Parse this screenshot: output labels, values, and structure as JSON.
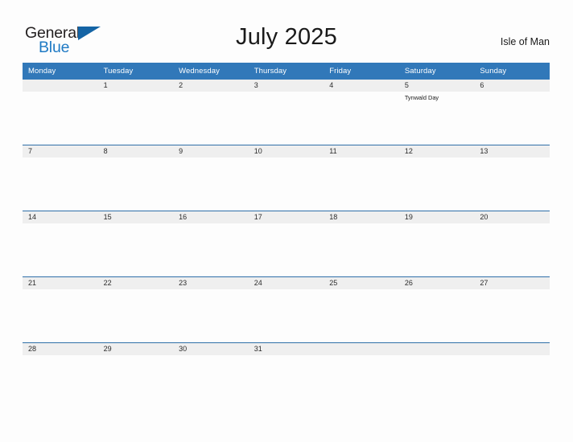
{
  "brand": {
    "name_part1": "General",
    "name_part2": "Blue",
    "flag_icon": "flag-triangle-icon",
    "accent_color": "#1f7ac4",
    "flag_color": "#1464a5"
  },
  "header": {
    "title": "July 2025",
    "locale": "Isle of Man"
  },
  "calendar": {
    "header_bg_color": "#3178b9",
    "daynum_band_color": "#efefef",
    "row_border_color": "#2f6fa8",
    "weekdays": [
      "Monday",
      "Tuesday",
      "Wednesday",
      "Thursday",
      "Friday",
      "Saturday",
      "Sunday"
    ],
    "weeks": [
      [
        {
          "day": "",
          "events": []
        },
        {
          "day": "1",
          "events": []
        },
        {
          "day": "2",
          "events": []
        },
        {
          "day": "3",
          "events": []
        },
        {
          "day": "4",
          "events": []
        },
        {
          "day": "5",
          "events": [
            "Tynwald Day"
          ]
        },
        {
          "day": "6",
          "events": []
        }
      ],
      [
        {
          "day": "7",
          "events": []
        },
        {
          "day": "8",
          "events": []
        },
        {
          "day": "9",
          "events": []
        },
        {
          "day": "10",
          "events": []
        },
        {
          "day": "11",
          "events": []
        },
        {
          "day": "12",
          "events": []
        },
        {
          "day": "13",
          "events": []
        }
      ],
      [
        {
          "day": "14",
          "events": []
        },
        {
          "day": "15",
          "events": []
        },
        {
          "day": "16",
          "events": []
        },
        {
          "day": "17",
          "events": []
        },
        {
          "day": "18",
          "events": []
        },
        {
          "day": "19",
          "events": []
        },
        {
          "day": "20",
          "events": []
        }
      ],
      [
        {
          "day": "21",
          "events": []
        },
        {
          "day": "22",
          "events": []
        },
        {
          "day": "23",
          "events": []
        },
        {
          "day": "24",
          "events": []
        },
        {
          "day": "25",
          "events": []
        },
        {
          "day": "26",
          "events": []
        },
        {
          "day": "27",
          "events": []
        }
      ],
      [
        {
          "day": "28",
          "events": []
        },
        {
          "day": "29",
          "events": []
        },
        {
          "day": "30",
          "events": []
        },
        {
          "day": "31",
          "events": []
        },
        {
          "day": "",
          "events": []
        },
        {
          "day": "",
          "events": []
        },
        {
          "day": "",
          "events": []
        }
      ]
    ]
  }
}
